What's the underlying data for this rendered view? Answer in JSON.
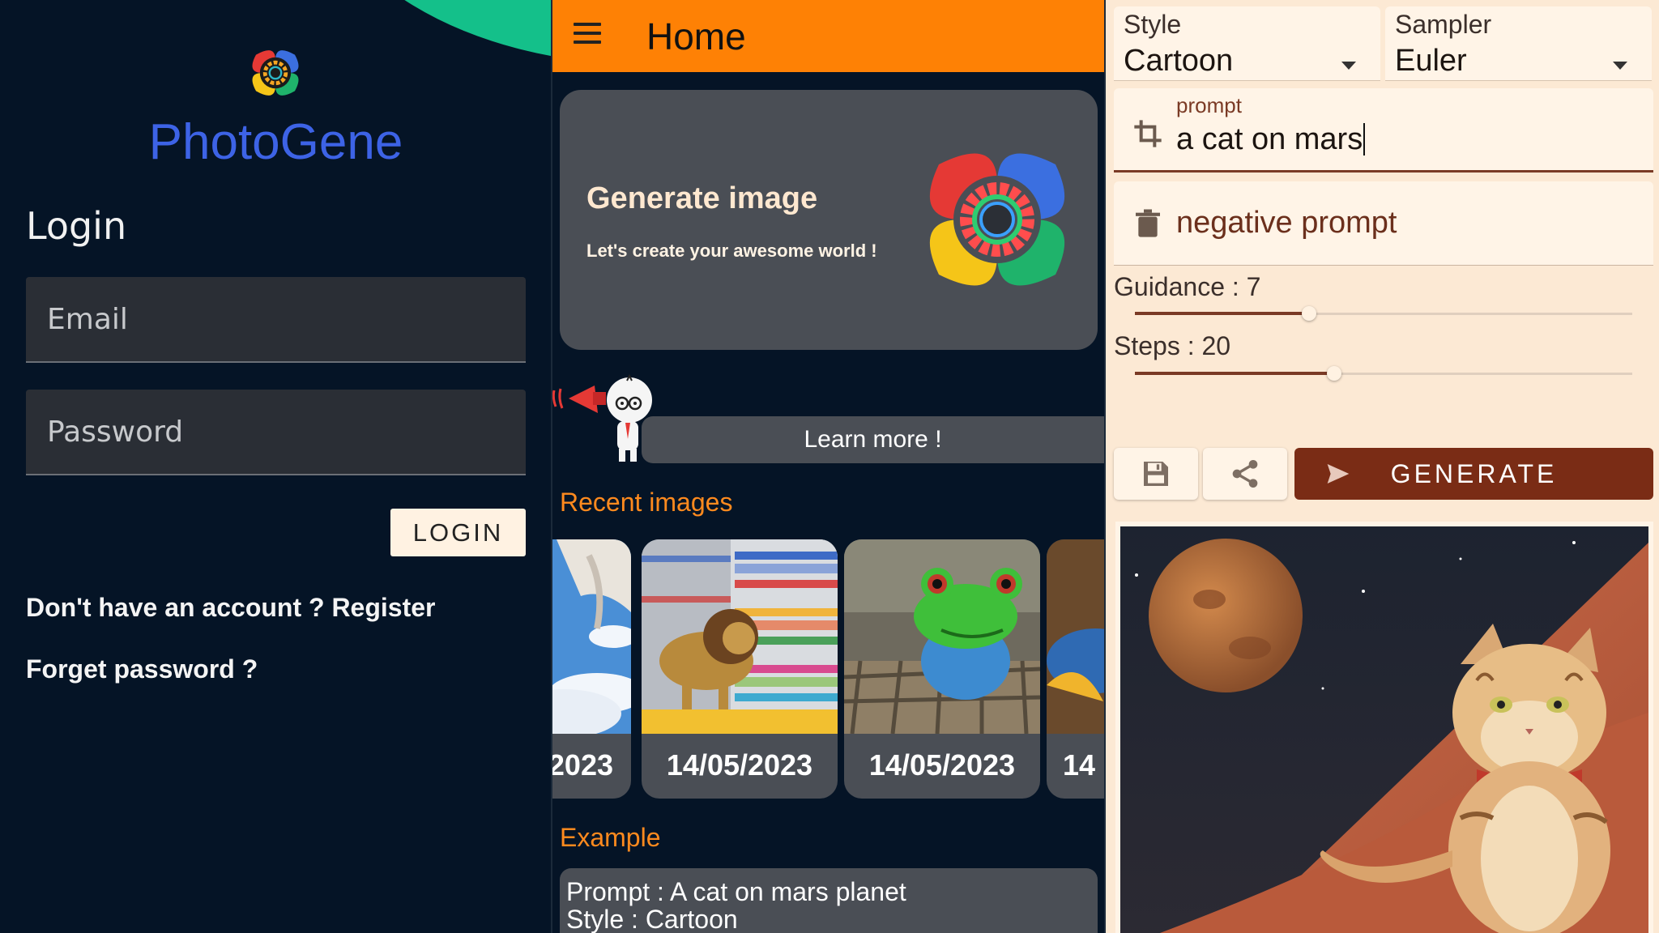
{
  "login": {
    "brand": "PhotoGene",
    "title": "Login",
    "email_placeholder": "Email",
    "password_placeholder": "Password",
    "login_button": "LOGIN",
    "register_link": "Don't have an account ? Register",
    "forget_link": "Forget password ?"
  },
  "home": {
    "appbar_title": "Home",
    "hero_title": "Generate image",
    "hero_subtitle": "Let's create your awesome world !",
    "learn_more": "Learn more !",
    "recent_title": "Recent images",
    "recent": [
      {
        "date": "2023"
      },
      {
        "date": "14/05/2023"
      },
      {
        "date": "14/05/2023"
      },
      {
        "date": "14"
      }
    ],
    "example_title": "Example",
    "example_prompt": "Prompt : A cat on mars planet",
    "example_style": "Style : Cartoon"
  },
  "generate": {
    "style_label": "Style",
    "style_value": "Cartoon",
    "sampler_label": "Sampler",
    "sampler_value": "Euler",
    "prompt_label": "prompt",
    "prompt_value": "a cat on mars",
    "negative_placeholder": "negative prompt",
    "guidance_label": "Guidance : 7",
    "guidance_fraction": 0.35,
    "steps_label": "Steps : 20",
    "steps_fraction": 0.4,
    "generate_button": "GENERATE"
  },
  "colors": {
    "background": "#051426",
    "accent_orange": "#fe8105",
    "accent_green": "#14c08a",
    "brand_blue": "#3d63e6",
    "generate_brown": "#7a2c15",
    "panel3_bg": "#fce9d4"
  },
  "icons": [
    "app-logo-icon",
    "menu-icon",
    "crop-icon",
    "trash-icon",
    "save-icon",
    "share-icon",
    "send-icon",
    "megaphone-mascot"
  ]
}
